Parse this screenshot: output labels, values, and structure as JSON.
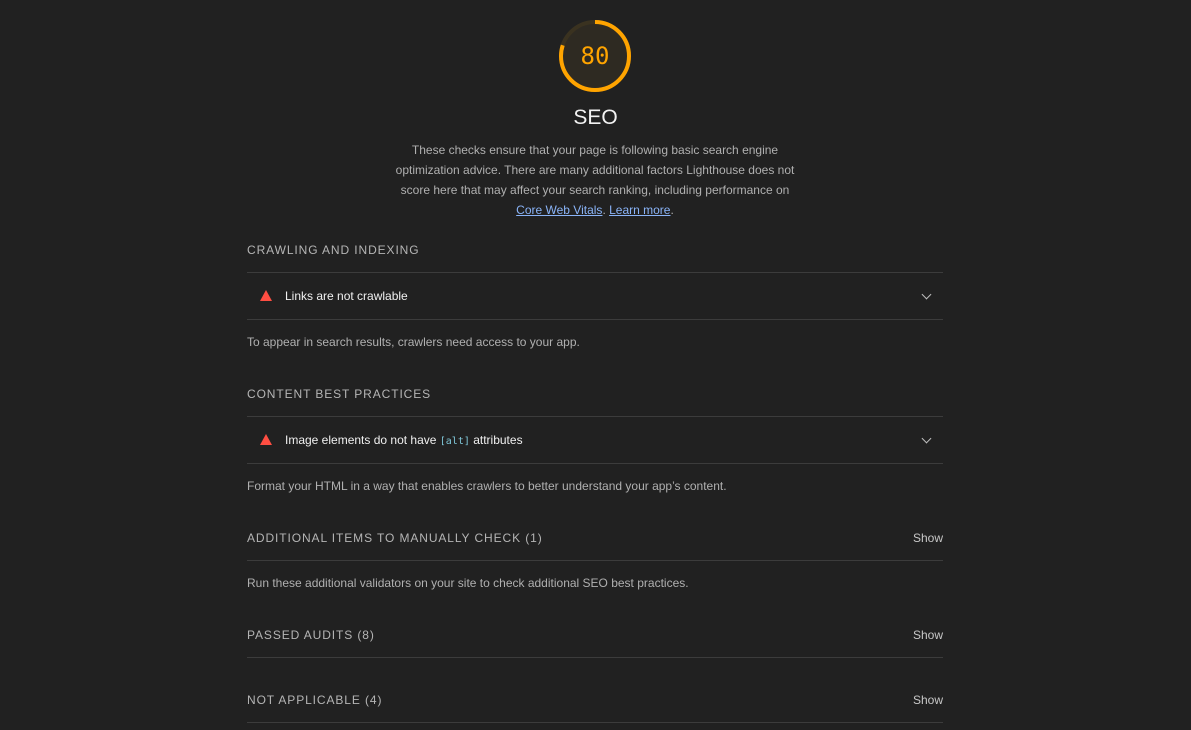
{
  "score": {
    "value": "80",
    "fraction": 0.8,
    "color": "#ffa400",
    "track_color": "#3a3220"
  },
  "category": {
    "title": "SEO",
    "description_text": "These checks ensure that your page is following basic search engine optimization advice. There are many additional factors Lighthouse does not score here that may affect your search ranking, including performance on ",
    "core_web_vitals_link": "Core Web Vitals",
    "separator": ". ",
    "learn_more_link": "Learn more",
    "end": "."
  },
  "groups": {
    "crawling": {
      "title": "CRAWLING AND INDEXING",
      "audit_title": "Links are not crawlable",
      "audit_icon": "fail-triangle-icon",
      "description": "To appear in search results, crawlers need access to your app."
    },
    "content": {
      "title": "CONTENT BEST PRACTICES",
      "audit_title_prefix": "Image elements do not have ",
      "audit_code": "[alt]",
      "audit_title_suffix": " attributes",
      "audit_icon": "fail-triangle-icon",
      "description": "Format your HTML in a way that enables crawlers to better understand your app’s content."
    },
    "manual": {
      "title": "ADDITIONAL ITEMS TO MANUALLY CHECK (1)",
      "toggle": "Show",
      "description": "Run these additional validators on your site to check additional SEO best practices."
    },
    "passed": {
      "title": "PASSED AUDITS (8)",
      "toggle": "Show"
    },
    "not_applicable": {
      "title": "NOT APPLICABLE (4)",
      "toggle": "Show"
    }
  },
  "colors": {
    "background": "#212121",
    "fail": "#ff4e42",
    "link": "#8ab4f8",
    "code": "#7fc7d9"
  }
}
